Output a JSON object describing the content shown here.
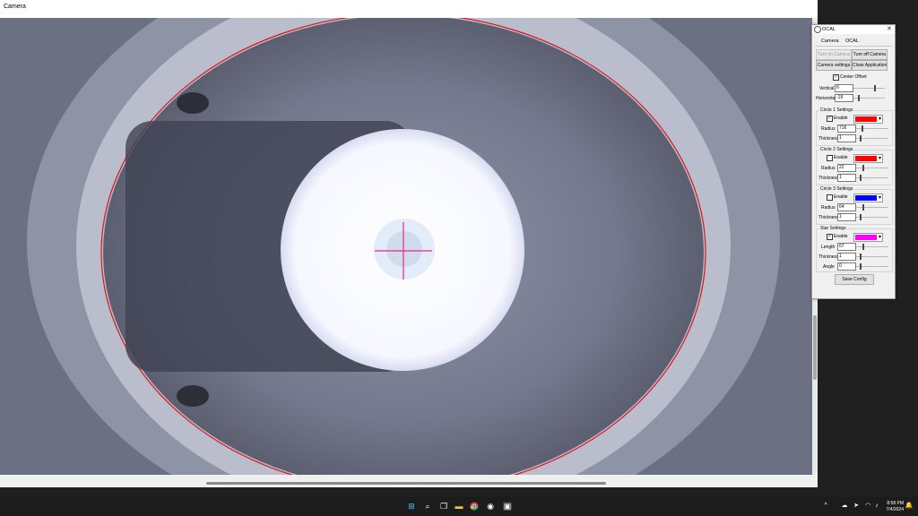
{
  "camera_window": {
    "title": "Camera"
  },
  "ocal": {
    "title": "OCAL",
    "close": "✕",
    "tabs": [
      "Camera",
      "OCAL"
    ],
    "buttons": {
      "turn_on": "Turn on Camera",
      "turn_off": "Turn off Camera",
      "settings": "Camera settings",
      "close_app": "Close Application",
      "save": "Save Config"
    },
    "center_offset": {
      "label": "Center Offset",
      "checked": true
    },
    "vertical": {
      "label": "Vertical",
      "value": "6"
    },
    "horizontal": {
      "label": "Horizontal",
      "value": "-19"
    },
    "circle1": {
      "title": "Circle 1 Settings",
      "enable_label": "Enable",
      "enabled": true,
      "color": "#ff0000",
      "radius_label": "Radius",
      "radius": "716",
      "thickness_label": "Thickness",
      "thickness": "1"
    },
    "circle2": {
      "title": "Circle 2 Settings",
      "enable_label": "Enable",
      "enabled": false,
      "color": "#ff0000",
      "radius_label": "Radius",
      "radius": "22",
      "thickness_label": "Thickness",
      "thickness": "1"
    },
    "circle3": {
      "title": "Circle 3 Settings",
      "enable_label": "Enable",
      "enabled": false,
      "color": "#0000ff",
      "radius_label": "Radius",
      "radius": "64",
      "thickness_label": "Thickness",
      "thickness": "1"
    },
    "star": {
      "title": "Star Settings",
      "enable_label": "Enable",
      "enabled": true,
      "color": "#ff00ff",
      "length_label": "Length",
      "length": "67",
      "thickness_label": "Thickness",
      "thickness": "1",
      "angle_label": "Angle",
      "angle": "0"
    }
  },
  "taskbar": {
    "icons": [
      "windows-start-icon",
      "search-icon",
      "task-view-icon",
      "file-explorer-icon",
      "chrome-icon",
      "app-icon",
      "camera-app-icon"
    ],
    "time": "8:58 PM",
    "date": "7/4/2024"
  }
}
